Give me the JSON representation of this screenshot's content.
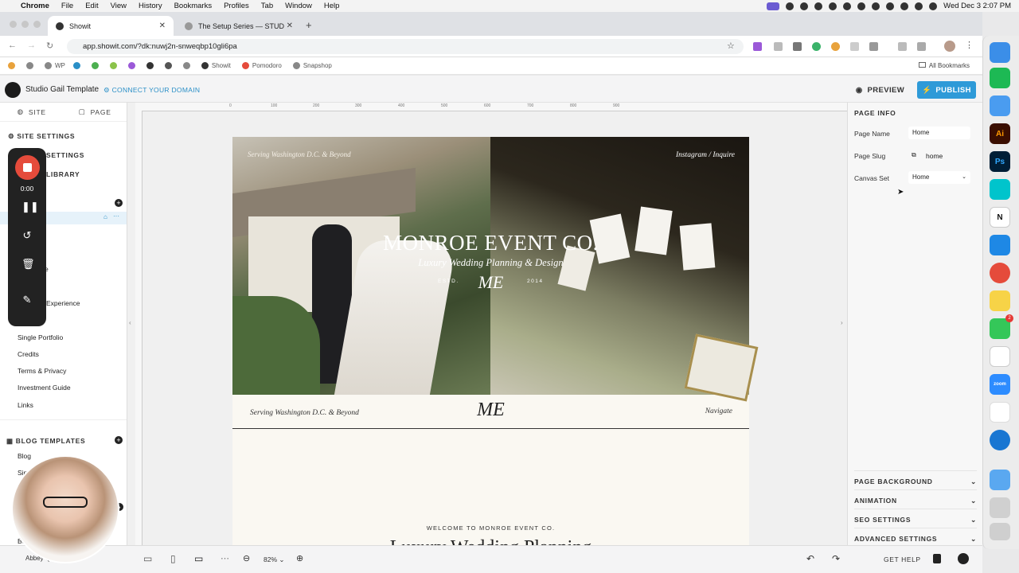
{
  "mac_menubar": {
    "app": "Chrome",
    "items": [
      "File",
      "Edit",
      "View",
      "History",
      "Bookmarks",
      "Profiles",
      "Tab",
      "Window",
      "Help"
    ],
    "clock": "Wed Dec 3  2:07 PM"
  },
  "browser": {
    "tabs": [
      {
        "label": "Showit",
        "active": true
      },
      {
        "label": "The Setup Series — STUDIO",
        "active": false
      }
    ],
    "url": "app.showit.com/?dk:nuwj2n-snweqbp10gli6pa",
    "bookmarks": [
      "WP",
      "Showit",
      "Pomodoro",
      "Snapshop"
    ],
    "all_bookmarks": "All Bookmarks"
  },
  "showit": {
    "site_name": "Studio Gail Template",
    "connect_domain": "CONNECT YOUR DOMAIN",
    "preview": "PREVIEW",
    "publish": "PUBLISH"
  },
  "left_panel": {
    "tab_site": "SITE",
    "tab_page": "PAGE",
    "site_settings": "SITE SETTINGS",
    "settings_partial": "SETTINGS",
    "library_partial": "LIBRARY",
    "experience_partial": "Experience",
    "e_partial": "e",
    "pages": [
      "Single Portfolio",
      "Credits",
      "Terms & Privacy",
      "Investment Guide",
      "Links"
    ],
    "blog_templates": "BLOG TEMPLATES",
    "blog_items": [
      "Blog",
      "Sin"
    ],
    "user_name": "Abbey Quo",
    "bo_partial": "Bo"
  },
  "recorder": {
    "time": "0:00"
  },
  "canvas": {
    "ruler_ticks": [
      "0",
      "100",
      "200",
      "300",
      "400",
      "500",
      "600",
      "700",
      "800",
      "900"
    ],
    "hero_left": "Serving Washington D.C. & Beyond",
    "hero_right": "Instagram / Inquire",
    "hero_title": "MONROE EVENT CO.",
    "hero_subtitle": "Luxury Wedding Planning & Design",
    "estd": "ESTD.",
    "est_year": "2014",
    "monogram": "ME",
    "nav_left": "Serving Washington D.C. & Beyond",
    "nav_right": "Navigate",
    "welcome": "WELCOME TO MONROE EVENT CO.",
    "heading_partial": "Luxury Wedding Planning"
  },
  "right_panel": {
    "page_info": "PAGE INFO",
    "page_name_label": "Page Name",
    "page_name_value": "Home",
    "page_slug_label": "Page Slug",
    "page_slug_value": "home",
    "canvas_set_label": "Canvas Set",
    "canvas_set_value": "Home",
    "sections": [
      "PAGE BACKGROUND",
      "ANIMATION",
      "SEO SETTINGS",
      "ADVANCED SETTINGS"
    ]
  },
  "bottom_bar": {
    "zoom": "82%",
    "get_help": "GET HELP"
  },
  "dock": {
    "messages_badge": "2",
    "apps": [
      "Finder",
      "Spotify",
      "Mail",
      "Illustrator",
      "Photoshop",
      "Canva",
      "Notion",
      "Safari",
      "Chrome",
      "Notes",
      "Messages",
      "ChatGPT",
      "Zoom",
      "Slack",
      "Compass",
      "Folder",
      "Preview",
      "Trash"
    ]
  },
  "colors": {
    "accent_blue": "#2e9ad8",
    "record_red": "#e54b3b",
    "page_bg": "#faf8f2"
  }
}
